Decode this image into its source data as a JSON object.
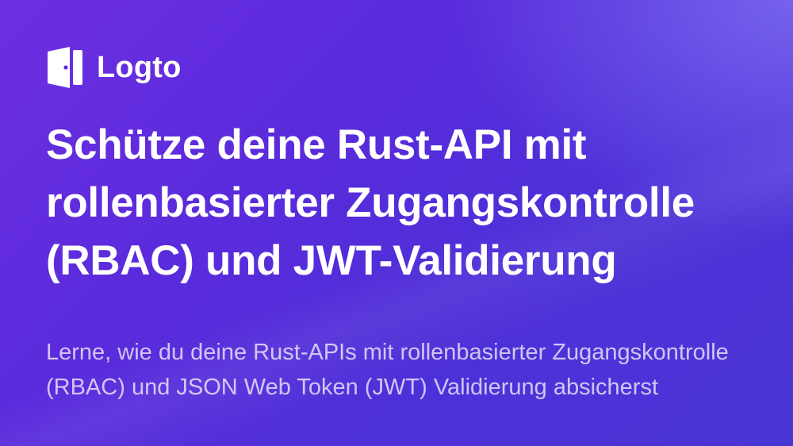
{
  "brand": {
    "logo_icon": "logto-door-icon",
    "name": "Logto"
  },
  "headline": "Schütze deine Rust-API mit rollenbasierter Zugangskontrolle (RBAC) und JWT-Validierung",
  "description": "Lerne, wie du deine Rust-APIs mit rollenbasierter Zugangskontrolle (RBAC) und JSON Web Token (JWT) Validierung absicherst",
  "colors": {
    "background_start": "#6d2fe0",
    "background_end": "#4a36d6",
    "text_primary": "#ffffff"
  }
}
